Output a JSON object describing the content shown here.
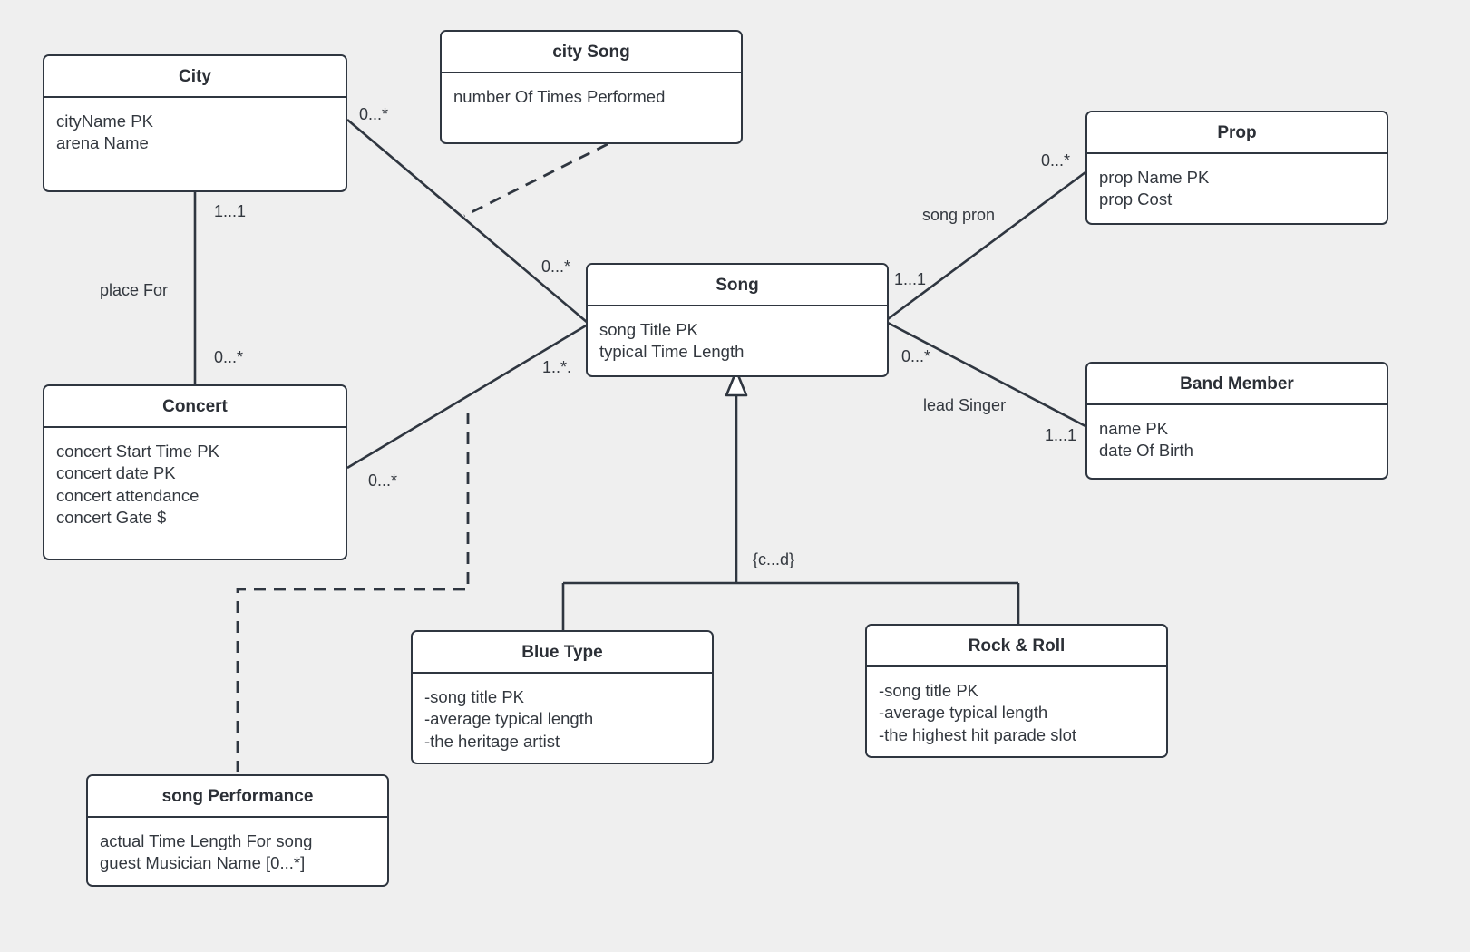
{
  "diagram": {
    "title": "Concert / Song UML Class Diagram",
    "background_color": "#efefef",
    "line_color": "#2f3640",
    "box_fill": "#ffffff",
    "text_color": "#33383f"
  },
  "classes": [
    {
      "id": "city",
      "name": "City",
      "attributes": [
        "cityName PK",
        "arena Name"
      ]
    },
    {
      "id": "city_song",
      "name": "city Song",
      "attributes": [
        "number Of Times Performed"
      ]
    },
    {
      "id": "prop",
      "name": "Prop",
      "attributes": [
        "prop Name PK",
        "prop Cost"
      ]
    },
    {
      "id": "song",
      "name": "Song",
      "attributes": [
        "song Title PK",
        "typical Time Length"
      ]
    },
    {
      "id": "band_member",
      "name": "Band Member",
      "attributes": [
        "name PK",
        "date Of Birth"
      ]
    },
    {
      "id": "concert",
      "name": "Concert",
      "attributes": [
        "concert Start Time PK",
        "concert date PK",
        "concert attendance",
        "concert Gate $"
      ]
    },
    {
      "id": "blue_type",
      "name": "Blue Type",
      "attributes": [
        "-song title PK",
        "-average typical length",
        "-the heritage artist"
      ]
    },
    {
      "id": "rock_roll",
      "name": "Rock & Roll",
      "attributes": [
        "-song title PK",
        "-average typical length",
        "-the highest hit parade slot"
      ]
    },
    {
      "id": "song_performance",
      "name": "song Performance",
      "attributes": [
        "actual Time Length For song",
        "guest Musician Name [0...*]"
      ]
    }
  ],
  "labels": {
    "city_to_song_mult": "0...*",
    "song_from_city_mult": "0...*",
    "city_to_concert_mult_top": "1...1",
    "city_to_concert_role": "place For",
    "city_to_concert_mult_bottom": "0...*",
    "concert_to_song_mult": "0...*",
    "song_from_concert_mult": "1..*.",
    "song_to_prop_mult": "1...1",
    "prop_mult": "0...*",
    "song_prop_role": "song pron",
    "song_to_band_mult": "0...*",
    "band_mult": "1...1",
    "song_band_role": "lead Singer",
    "generalization_constraint": "{c...d}"
  }
}
